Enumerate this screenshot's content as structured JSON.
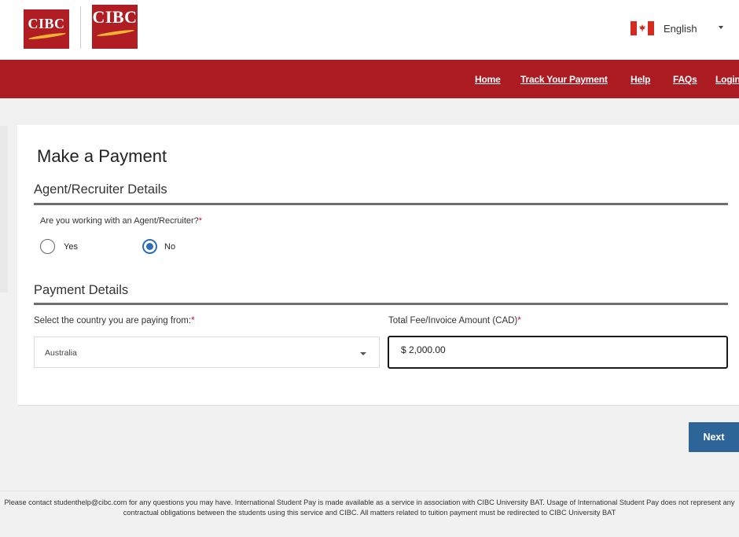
{
  "header": {
    "logo_text": "CIBC",
    "language": {
      "label": "English",
      "flag_icon": "canada-flag-icon"
    }
  },
  "nav": {
    "home": "Home",
    "track": "Track Your Payment",
    "help": "Help",
    "faqs": "FAQs",
    "login": "Login"
  },
  "main": {
    "title": "Make a Payment",
    "agent_section": {
      "title": "Agent/Recruiter Details",
      "question": "Are you working with an Agent/Recruiter?",
      "required_mark": "*",
      "options": [
        {
          "label": "Yes",
          "checked": false
        },
        {
          "label": "No",
          "checked": true
        }
      ]
    },
    "payment_section": {
      "title": "Payment Details",
      "country_label": "Select the country you are paying from:",
      "country_value": "Australia",
      "amount_label": "Total Fee/Invoice Amount (CAD)",
      "amount_value": "$ 2,000.00",
      "required_mark": "*"
    },
    "next_label": "Next"
  },
  "footer": {
    "text": "Please contact studenthelp@cibc.com for any questions you may have. International Student Pay is made available as a service in association with CIBC University BAT. Usage of International Student Pay does not represent any contractual obligations between the students using this service and CIBC. All matters related to tuition payment must be redirected to CIBC University BAT"
  },
  "colors": {
    "brand_red": "#ad1b22",
    "primary_blue": "#2e6599",
    "radio_blue": "#2f6db5",
    "required_red": "#c8102e"
  }
}
